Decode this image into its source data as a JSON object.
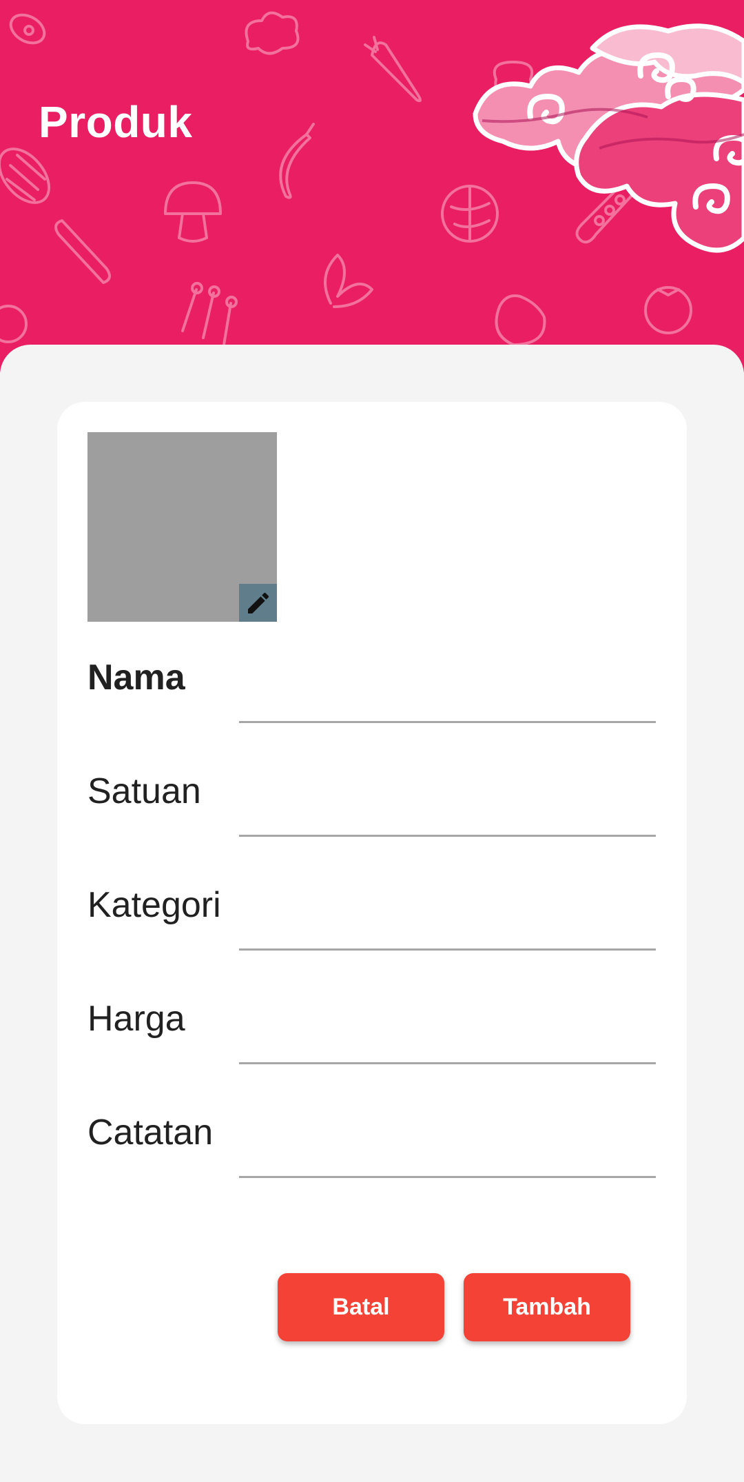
{
  "header": {
    "title": "Produk",
    "background_color": "#e91e63",
    "decorations": [
      "vegetable-pattern",
      "batik-cloud-ornament"
    ]
  },
  "product_image": {
    "placeholder_color": "#9e9e9e",
    "edit_icon": "pencil-icon",
    "edit_button_color": "#607d8b"
  },
  "form": {
    "fields": [
      {
        "label": "Nama",
        "value": ""
      },
      {
        "label": "Satuan",
        "value": ""
      },
      {
        "label": "Kategori",
        "value": ""
      },
      {
        "label": "Harga",
        "value": ""
      },
      {
        "label": "Catatan",
        "value": ""
      }
    ]
  },
  "actions": {
    "cancel_label": "Batal",
    "submit_label": "Tambah",
    "button_color": "#f44336"
  }
}
